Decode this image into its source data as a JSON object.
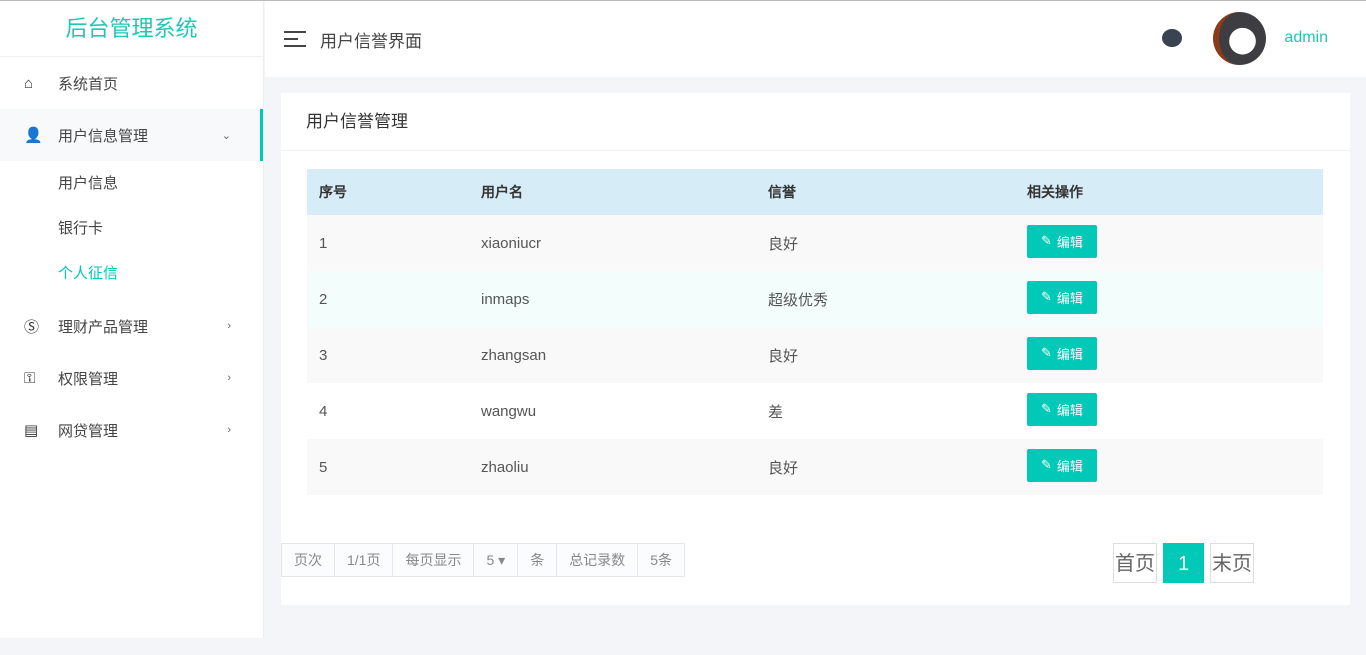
{
  "app": {
    "title": "后台管理系统"
  },
  "sidebar": {
    "items": [
      {
        "label": "系统首页"
      },
      {
        "label": "用户信息管理"
      },
      {
        "label": "理财产品管理"
      },
      {
        "label": "权限管理"
      },
      {
        "label": "网贷管理"
      }
    ],
    "sub": [
      "用户信息",
      "银行卡",
      "个人征信"
    ]
  },
  "header": {
    "title": "用户信誉界面",
    "user": "admin"
  },
  "card": {
    "title": "用户信誉管理"
  },
  "table": {
    "headers": [
      "序号",
      "用户名",
      "信誉",
      "相关操作"
    ],
    "rows": [
      [
        "1",
        "xiaoniucr",
        "良好"
      ],
      [
        "2",
        "inmaps",
        "超级优秀"
      ],
      [
        "3",
        "zhangsan",
        "良好"
      ],
      [
        "4",
        "wangwu",
        "差"
      ],
      [
        "5",
        "zhaoliu",
        "良好"
      ]
    ],
    "edit_label": "编辑"
  },
  "pagination": {
    "page_label": "页次",
    "page": "1/1页",
    "per_page_label": "每页显示",
    "per_page": "5",
    "unit": "条",
    "total_label": "总记录数",
    "total": "5条",
    "first": "首页",
    "current": "1",
    "last": "末页"
  },
  "colors": {
    "accent": "#00c9b7"
  }
}
